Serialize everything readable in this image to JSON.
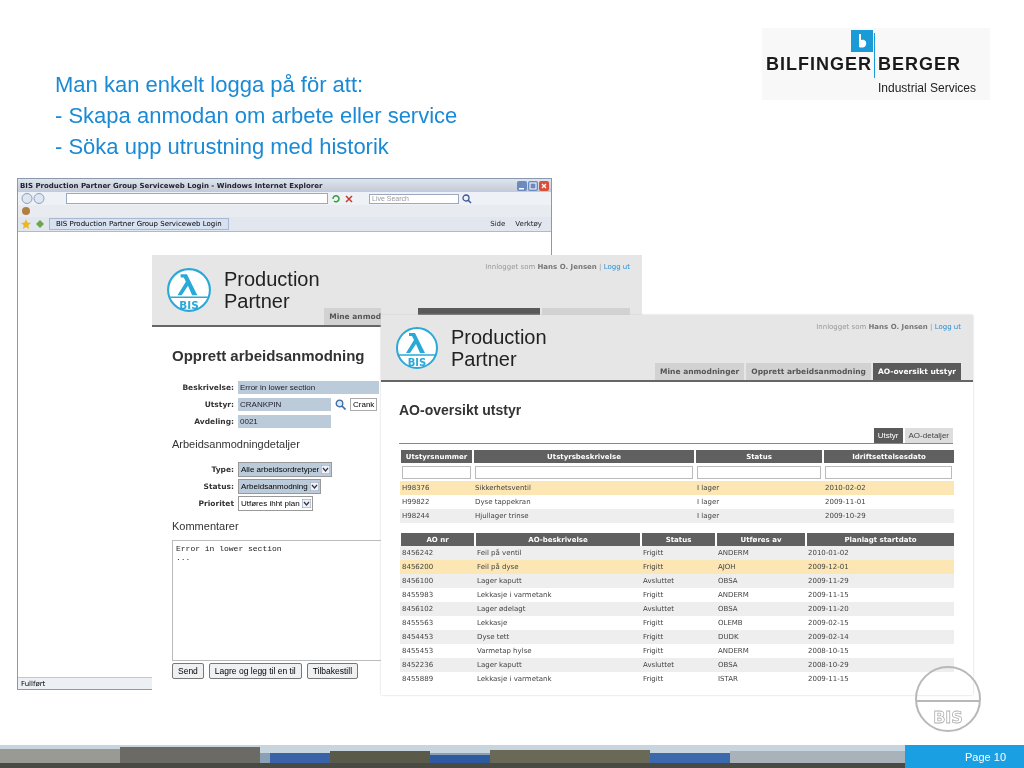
{
  "heading_lines": [
    "Man kan enkelt logga på för att:",
    "- Skapa anmodan om arbete eller service",
    "- Söka upp utrustning med historik"
  ],
  "company_logo": {
    "name_left": "BILFINGER",
    "name_right": "BERGER",
    "tagline": "Industrial Services"
  },
  "browser": {
    "title": "BIS Production Partner Group Serviceweb Login - Windows Internet Explorer",
    "search_placeholder": "Live Search",
    "tab_label": "BIS Production Partner Group Serviceweb Login",
    "toolbar_items": [
      "Side",
      "Verktøy"
    ],
    "status_text": "Fullført"
  },
  "request_window": {
    "logo": {
      "line1": "Production",
      "line2": "Partner",
      "badge": "BIS"
    },
    "login_prefix": "Innlogget som",
    "user": "Hans O. Jensen",
    "separator": "|",
    "logout": "Logg ut",
    "tabs": [
      {
        "label": "Mine anmod",
        "selected": false
      },
      {
        "selected": true
      },
      {
        "selected": false
      }
    ],
    "title": "Opprett arbeidsanmodning",
    "fields": [
      {
        "label": "Beskrivelse:",
        "value": "Error in lower section"
      },
      {
        "label": "Utstyr:",
        "value": "CRANKPIN",
        "side_button": "Crank"
      },
      {
        "label": "Avdeling:",
        "value": "0021"
      }
    ],
    "details_heading": "Arbeidsanmodningdetaljer",
    "selects": [
      {
        "label": "Type:",
        "value": "Alle arbeidsordretyper",
        "highlighted": true
      },
      {
        "label": "Status:",
        "value": "Arbeidsanmodning",
        "highlighted": true
      },
      {
        "label": "Prioritet",
        "value": "Utføres ihht plan",
        "highlighted": false
      }
    ],
    "comments_heading": "Kommentarer",
    "comment_lines": [
      "Error in lower section",
      "..."
    ],
    "buttons": [
      "Send",
      "Lagre og legg til en til",
      "Tilbakestill"
    ]
  },
  "overview_window": {
    "logo": {
      "line1": "Production",
      "line2": "Partner",
      "badge": "BIS"
    },
    "login_prefix": "Innlogget som",
    "user": "Hans O. Jensen",
    "separator": "|",
    "logout": "Logg ut",
    "tabs": [
      {
        "label": "Mine anmodninger",
        "selected": false
      },
      {
        "label": "Opprett arbeidsanmodning",
        "selected": false
      },
      {
        "label": "AO-oversikt utstyr",
        "selected": true
      }
    ],
    "title": "AO-oversikt utstyr",
    "view_tabs": [
      {
        "label": "Utstyr",
        "selected": true
      },
      {
        "label": "AO-detaljer",
        "selected": false
      }
    ],
    "equipment_table": {
      "columns": [
        "Utstyrsnummer",
        "Utstyrsbeskrivelse",
        "Status",
        "Idriftsettelsesdato"
      ],
      "rows": [
        {
          "cells": [
            "H98376",
            "Sikkerhetsventil",
            "I lager",
            "2010-02-02"
          ],
          "selected": true
        },
        {
          "cells": [
            "H99822",
            "Dyse tappekran",
            "I lager",
            "2009-11-01"
          ],
          "selected": false
        },
        {
          "cells": [
            "H98244",
            "Hjullager trinse",
            "I lager",
            "2009-10-29"
          ],
          "selected": false
        }
      ]
    },
    "orders_table": {
      "columns": [
        "AO nr",
        "AO-beskrivelse",
        "Status",
        "Utføres av",
        "Planlagt startdato"
      ],
      "rows": [
        {
          "cells": [
            "8456242",
            "Feil på ventil",
            "Frigitt",
            "ANDERM",
            "2010-01-02"
          ],
          "selected": false
        },
        {
          "cells": [
            "8456200",
            "Feil på dyse",
            "Frigitt",
            "AJOH",
            "2009-12-01"
          ],
          "selected": true
        },
        {
          "cells": [
            "8456100",
            "Lager kaputt",
            "Avsluttet",
            "OBSA",
            "2009-11-29"
          ],
          "selected": false
        },
        {
          "cells": [
            "8455983",
            "Lekkasje i varmetank",
            "Frigitt",
            "ANDERM",
            "2009-11-15"
          ],
          "selected": false
        },
        {
          "cells": [
            "8456102",
            "Lager ødelagt",
            "Avsluttet",
            "OBSA",
            "2009-11-20"
          ],
          "selected": false
        },
        {
          "cells": [
            "8455563",
            "Lekkasje",
            "Frigitt",
            "OLEMB",
            "2009-02-15"
          ],
          "selected": false
        },
        {
          "cells": [
            "8454453",
            "Dyse tett",
            "Frigitt",
            "DUDK",
            "2009-02-14"
          ],
          "selected": false
        },
        {
          "cells": [
            "8455453",
            "Varmetap hylse",
            "Frigitt",
            "ANDERM",
            "2008-10-15"
          ],
          "selected": false
        },
        {
          "cells": [
            "8452236",
            "Lager kaputt",
            "Avsluttet",
            "OBSA",
            "2008-10-29"
          ],
          "selected": false
        },
        {
          "cells": [
            "8455889",
            "Lekkasje i varmetank",
            "Frigitt",
            "ISTAR",
            "2009-11-15"
          ],
          "selected": false
        }
      ]
    }
  },
  "corner_mark": {
    "badge": "BIS"
  },
  "page_label": "Page 10"
}
